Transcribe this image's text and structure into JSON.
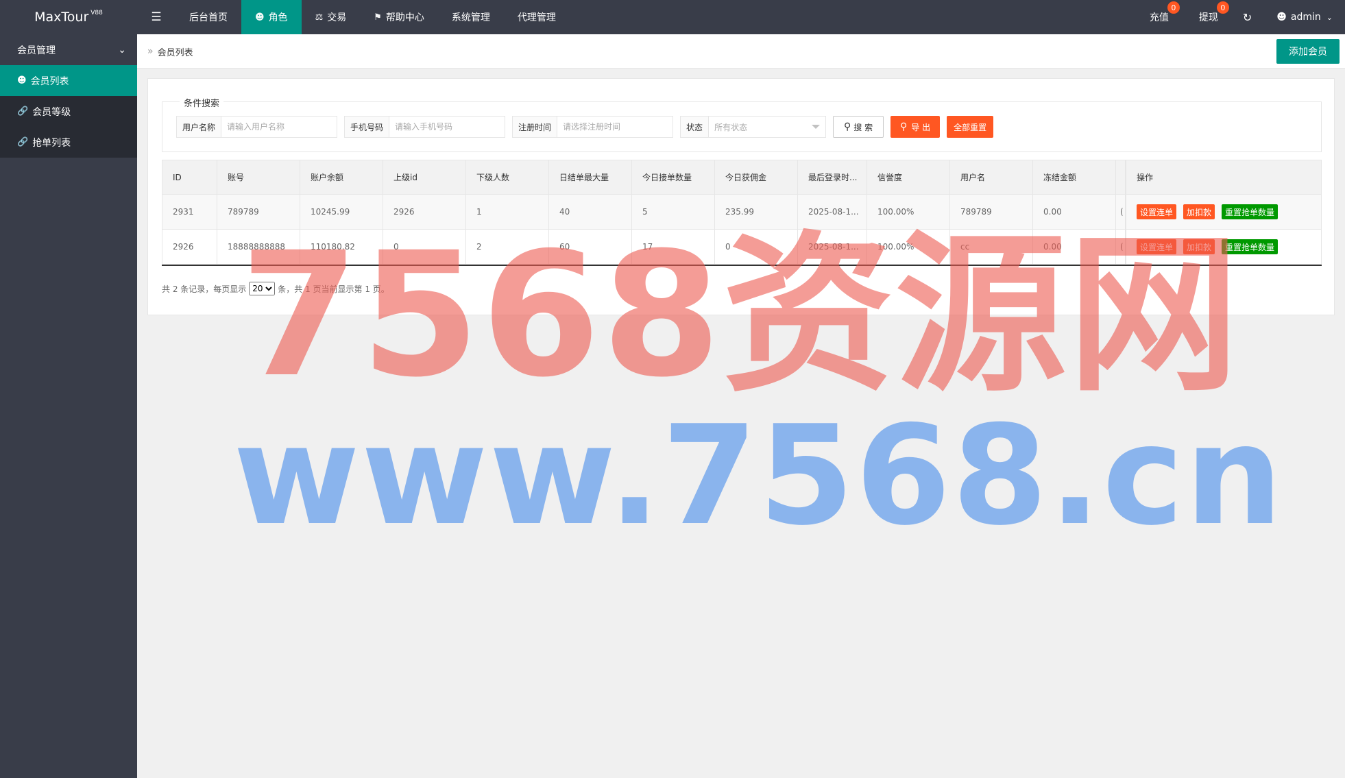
{
  "app": {
    "name": "MaxTour",
    "version": "V88"
  },
  "nav": [
    {
      "label": "后台首页",
      "icon": ""
    },
    {
      "label": "角色",
      "icon": "user-icon",
      "active": true
    },
    {
      "label": "交易",
      "icon": "scale-icon"
    },
    {
      "label": "帮助中心",
      "icon": "flag-icon"
    },
    {
      "label": "系统管理",
      "icon": ""
    },
    {
      "label": "代理管理",
      "icon": ""
    }
  ],
  "header_right": {
    "recharge_label": "充值",
    "recharge_count": "0",
    "withdraw_label": "提现",
    "withdraw_count": "0",
    "user": "admin"
  },
  "sidebar": {
    "group": "会员管理",
    "items": [
      {
        "label": "会员列表",
        "icon": "user-icon",
        "active": true
      },
      {
        "label": "会员等级",
        "icon": "link-icon"
      },
      {
        "label": "抢单列表",
        "icon": "link-icon"
      }
    ]
  },
  "breadcrumb": {
    "current": "会员列表"
  },
  "add_button": "添加会员",
  "search": {
    "legend": "条件搜索",
    "username_label": "用户名称",
    "username_placeholder": "请输入用户名称",
    "phone_label": "手机号码",
    "phone_placeholder": "请输入手机号码",
    "regtime_label": "注册时间",
    "regtime_placeholder": "请选择注册时间",
    "status_label": "状态",
    "status_value": "所有状态",
    "search_btn": "搜 索",
    "export_btn": "导 出",
    "reset_btn": "全部重置"
  },
  "table": {
    "headers": [
      "ID",
      "账号",
      "账户余额",
      "上级id",
      "下级人数",
      "日结单最大量",
      "今日接单数量",
      "今日获佣金",
      "最后登录时...",
      "信誉度",
      "用户名",
      "冻结金额",
      "",
      "操作"
    ],
    "rows": [
      [
        "2931",
        "789789",
        "10245.99",
        "2926",
        "1",
        "40",
        "5",
        "235.99",
        "2025-08-1...",
        "100.00%",
        "789789",
        "0.00",
        "("
      ],
      [
        "2926",
        "18888888888",
        "110180.82",
        "0",
        "2",
        "60",
        "17",
        "0",
        "2025-08-1...",
        "100.00%",
        "cc",
        "0.00",
        "("
      ]
    ],
    "actions": {
      "set_chain": "设置连单",
      "add_deduct": "加扣款",
      "reset_grab": "重置抢单数量"
    }
  },
  "pager": {
    "prefix": "共 2 条记录，每页显示",
    "page_size": "20",
    "suffix": "条，共 1 页当前显示第 1 页。"
  },
  "watermark": {
    "line1": "7568资源网",
    "line2": "www.7568.cn"
  },
  "colors": {
    "header_bg": "#393d49",
    "accent": "#009688",
    "danger": "#ff5722",
    "success": "#009900"
  }
}
